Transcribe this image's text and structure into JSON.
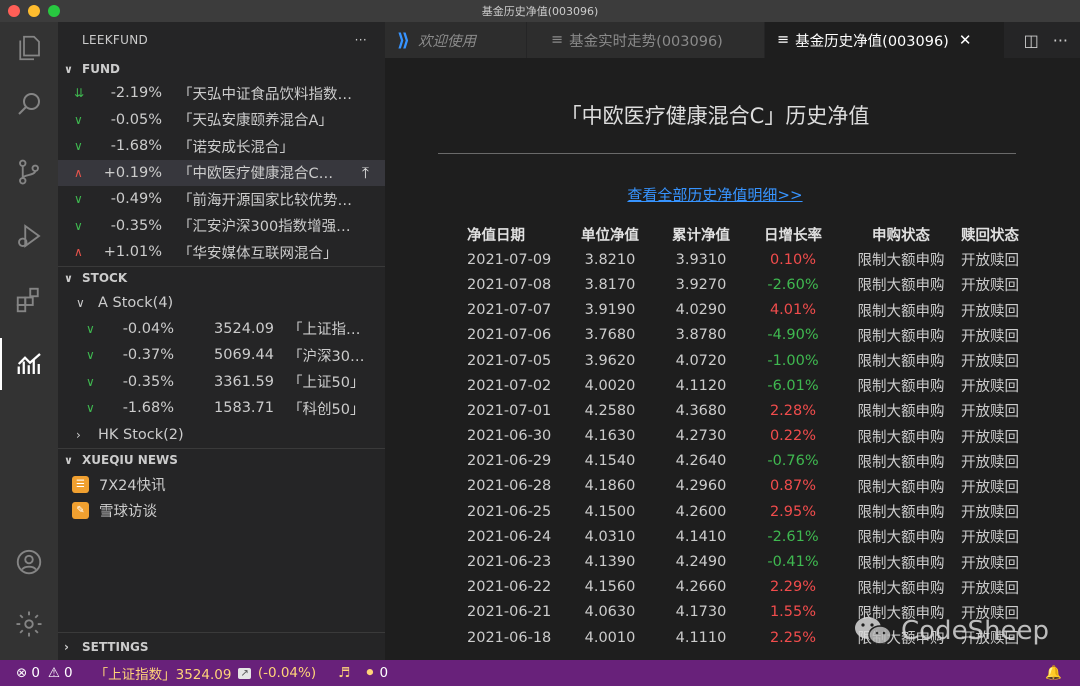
{
  "window": {
    "title": "基金历史净值(003096)"
  },
  "sidebar": {
    "title": "LEEKFUND",
    "more": "···",
    "fund_section": "FUND",
    "funds": [
      {
        "dir": "double-down",
        "pct": "-2.19%",
        "name": "「天弘中证食品饮料指数…"
      },
      {
        "dir": "down",
        "pct": "-0.05%",
        "name": "「天弘安康颐养混合A」"
      },
      {
        "dir": "down",
        "pct": "-1.68%",
        "name": "「诺安成长混合」"
      },
      {
        "dir": "up",
        "pct": "+0.19%",
        "name": "「中欧医疗健康混合C…"
      },
      {
        "dir": "down",
        "pct": "-0.49%",
        "name": "「前海开源国家比较优势…"
      },
      {
        "dir": "down",
        "pct": "-0.35%",
        "name": "「汇安沪深300指数增强…"
      },
      {
        "dir": "up",
        "pct": "+1.01%",
        "name": "「华安媒体互联网混合」"
      }
    ],
    "stock_section": "STOCK",
    "a_stock_group": "A Stock(4)",
    "stocks": [
      {
        "pct": "-0.04%",
        "price": "3524.09",
        "name": "「上证指…"
      },
      {
        "pct": "-0.37%",
        "price": "5069.44",
        "name": "「沪深30…"
      },
      {
        "pct": "-0.35%",
        "price": "3361.59",
        "name": "「上证50」"
      },
      {
        "pct": "-1.68%",
        "price": "1583.71",
        "name": "「科创50」"
      }
    ],
    "hk_stock_group": "HK Stock(2)",
    "news_section": "XUEQIU NEWS",
    "news": [
      "7X24快讯",
      "雪球访谈"
    ],
    "settings_section": "SETTINGS"
  },
  "tabs": [
    {
      "label": "欢迎使用",
      "icon": "vscode-icon"
    },
    {
      "label": "基金实时走势(003096)",
      "icon": "preview-icon"
    },
    {
      "label": "基金历史净值(003096)",
      "icon": "preview-icon",
      "active": true
    }
  ],
  "editor": {
    "heading": "「中欧医疗健康混合C」历史净值",
    "link": "查看全部历史净值明细>>",
    "columns": [
      "净值日期",
      "单位净值",
      "累计净值",
      "日增长率",
      "申购状态",
      "赎回状态"
    ],
    "rows": [
      [
        "2021-07-09",
        "3.8210",
        "3.9310",
        "0.10%",
        "限制大额申购",
        "开放赎回"
      ],
      [
        "2021-07-08",
        "3.8170",
        "3.9270",
        "-2.60%",
        "限制大额申购",
        "开放赎回"
      ],
      [
        "2021-07-07",
        "3.9190",
        "4.0290",
        "4.01%",
        "限制大额申购",
        "开放赎回"
      ],
      [
        "2021-07-06",
        "3.7680",
        "3.8780",
        "-4.90%",
        "限制大额申购",
        "开放赎回"
      ],
      [
        "2021-07-05",
        "3.9620",
        "4.0720",
        "-1.00%",
        "限制大额申购",
        "开放赎回"
      ],
      [
        "2021-07-02",
        "4.0020",
        "4.1120",
        "-6.01%",
        "限制大额申购",
        "开放赎回"
      ],
      [
        "2021-07-01",
        "4.2580",
        "4.3680",
        "2.28%",
        "限制大额申购",
        "开放赎回"
      ],
      [
        "2021-06-30",
        "4.1630",
        "4.2730",
        "0.22%",
        "限制大额申购",
        "开放赎回"
      ],
      [
        "2021-06-29",
        "4.1540",
        "4.2640",
        "-0.76%",
        "限制大额申购",
        "开放赎回"
      ],
      [
        "2021-06-28",
        "4.1860",
        "4.2960",
        "0.87%",
        "限制大额申购",
        "开放赎回"
      ],
      [
        "2021-06-25",
        "4.1500",
        "4.2600",
        "2.95%",
        "限制大额申购",
        "开放赎回"
      ],
      [
        "2021-06-24",
        "4.0310",
        "4.1410",
        "-2.61%",
        "限制大额申购",
        "开放赎回"
      ],
      [
        "2021-06-23",
        "4.1390",
        "4.2490",
        "-0.41%",
        "限制大额申购",
        "开放赎回"
      ],
      [
        "2021-06-22",
        "4.1560",
        "4.2660",
        "2.29%",
        "限制大额申购",
        "开放赎回"
      ],
      [
        "2021-06-21",
        "4.0630",
        "4.1730",
        "1.55%",
        "限制大额申购",
        "开放赎回"
      ],
      [
        "2021-06-18",
        "4.0010",
        "4.1110",
        "2.25%",
        "限制大额申购",
        "开放赎回"
      ]
    ],
    "watermark": "CodeSheep"
  },
  "statusbar": {
    "errors": "0",
    "warnings": "0",
    "ticker": "「上证指数」3524.09",
    "ticker_change": "(-0.04%)",
    "coins": "0"
  },
  "colors": {
    "status_bg": "#68217a",
    "up": "#f14c4c",
    "down": "#3fb950",
    "link": "#3794ff"
  }
}
